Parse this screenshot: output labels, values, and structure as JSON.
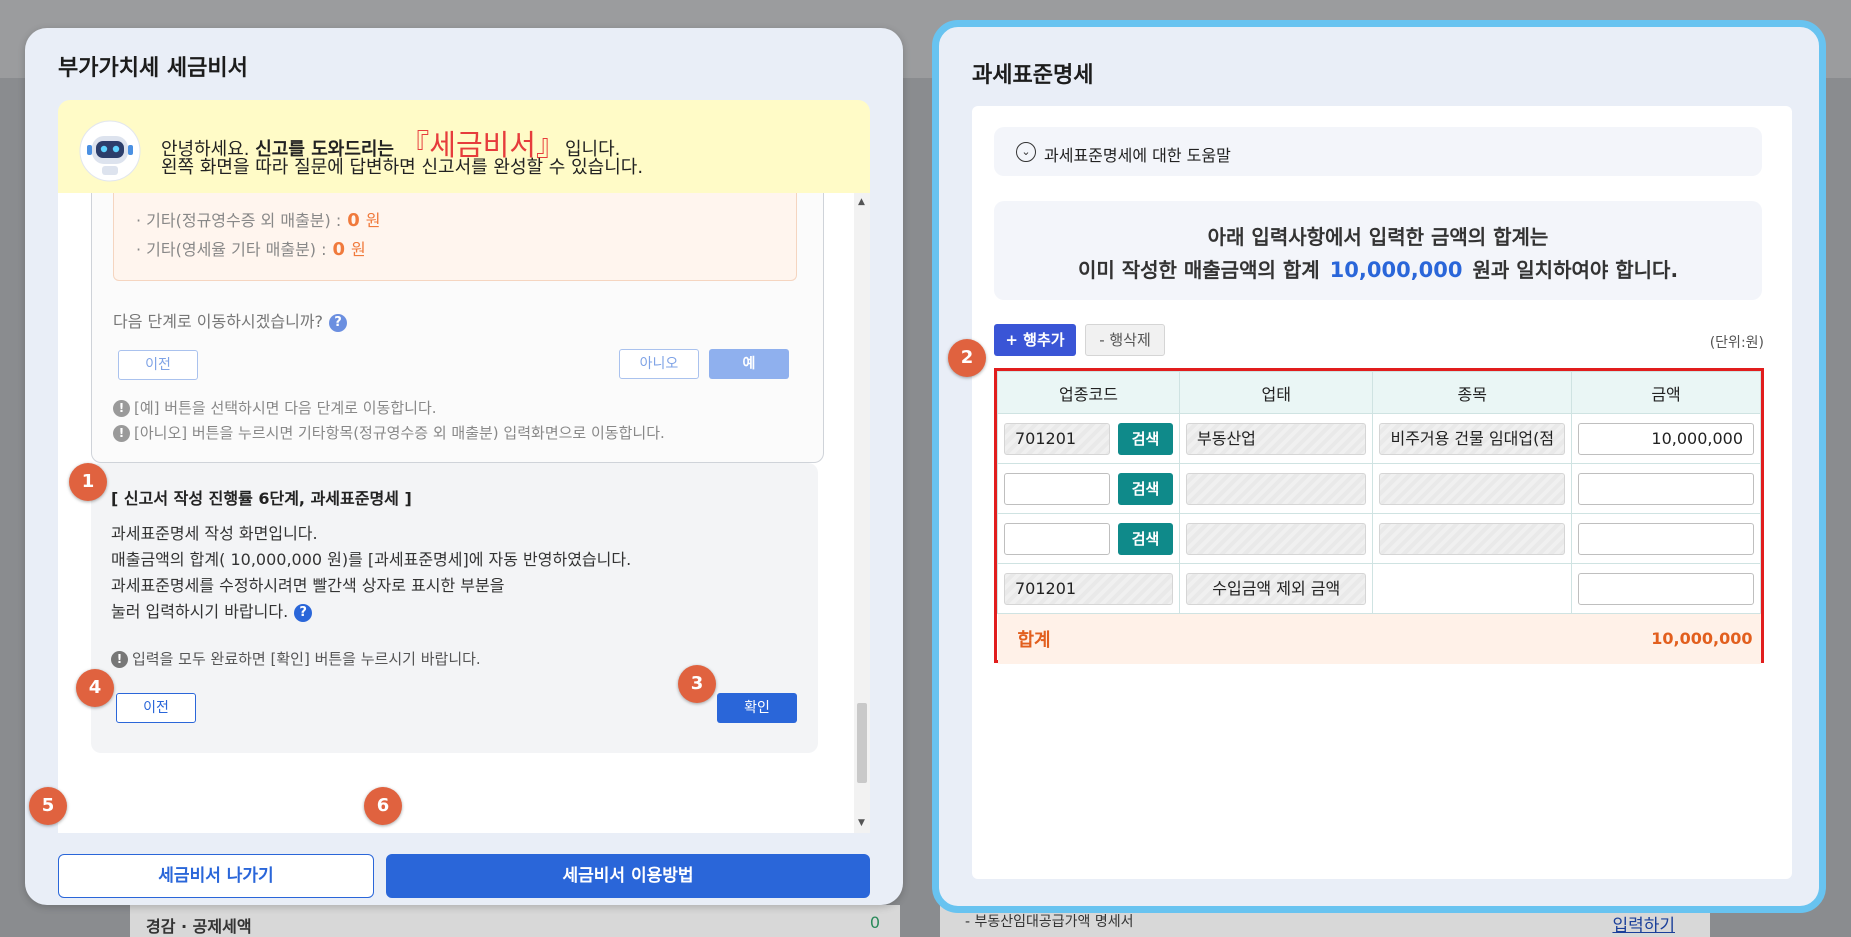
{
  "left_modal": {
    "title": "부가가치세 세금비서",
    "banner": {
      "greeting": "안녕하세요. ",
      "greeting_bold": "신고를 도와드리는 ",
      "brand": "『세금비서』",
      "greeting_end": "입니다.",
      "line2": "왼쪽 화면을 따라 질문에 답변하면 신고서를 완성할 수 있습니다."
    },
    "prev_step": {
      "items": [
        {
          "label": "· 기타(정규영수증 외 매출분) :",
          "value": "0",
          "unit": "원"
        },
        {
          "label": "· 기타(영세율 기타 매출분) :",
          "value": "0",
          "unit": "원"
        }
      ],
      "question": "다음 단계로 이동하시겠습니까?",
      "prev_label": "이전",
      "no_label": "아니오",
      "yes_label": "예",
      "note1": "[예] 버튼을 선택하시면 다음 단계로 이동합니다.",
      "note2": "[아니오] 버튼을 누르시면 기타항목(정규영수증 외 매출분) 입력화면으로 이동합니다."
    },
    "current_step": {
      "heading": "[ 신고서 작성 진행률 6단계, 과세표준명세 ]",
      "line1": "과세표준명세 작성 화면입니다.",
      "line2": "매출금액의 합계( 10,000,000 원)를 [과세표준명세]에 자동 반영하였습니다.",
      "line3": "과세표준명세를 수정하시려면 빨간색 상자로 표시한 부분을",
      "line4": "눌러 입력하시기 바랍니다.",
      "note": "입력을 모두 완료하면 [확인] 버튼을 누르시기 바랍니다.",
      "prev_label": "이전",
      "confirm_label": "확인"
    },
    "exit_label": "세금비서 나가기",
    "howto_label": "세금비서 이용방법"
  },
  "badges": [
    "1",
    "2",
    "3",
    "4",
    "5",
    "6"
  ],
  "right_modal": {
    "title": "과세표준명세",
    "help_label": "과세표준명세에 대한 도움말",
    "info_line1": "아래 입력사항에서 입력한 금액의 합계는",
    "info_line2_pre": "이미 작성한 매출금액의 합계",
    "info_amount": "10,000,000",
    "info_line2_post": "원과 일치하여야 합니다.",
    "add_row_label": "+ 행추가",
    "del_row_label": "- 행삭제",
    "unit_label": "(단위:원)",
    "table": {
      "headers": [
        "업종코드",
        "업태",
        "종목",
        "금액"
      ],
      "rows": [
        {
          "code": "701201",
          "type": "부동산업",
          "item": "비주거용 건물 임대업(점",
          "amount": "10,000,000"
        },
        {
          "code": "",
          "type": "",
          "item": "",
          "amount": ""
        },
        {
          "code": "",
          "type": "",
          "item": "",
          "amount": ""
        },
        {
          "code": "701201",
          "type": "수입금액 제외 금액",
          "item": "",
          "amount": ""
        }
      ],
      "search_label": "검색",
      "total_label": "합계",
      "total_value": "10,000,000"
    }
  },
  "background": {
    "row_label": "경감 · 공제세액",
    "row_value": "0",
    "right_row_label": "- 부동산임대공급가액 명세서",
    "right_row_link": "입력하기"
  },
  "colors": {
    "accent": "#2a66d9",
    "badge": "#e0623f",
    "highlight_border": "#e11d1d",
    "modal_outline": "#68c3f0"
  }
}
